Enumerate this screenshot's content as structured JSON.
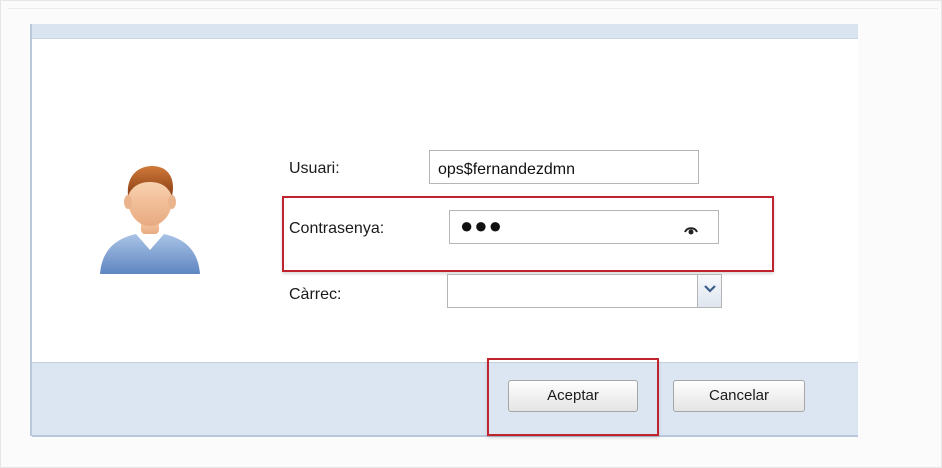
{
  "login": {
    "username_label": "Usuari:",
    "username_value": "ops$fernandezdmn",
    "password_label": "Contrasenya:",
    "password_mask": "●●●",
    "role_label": "Càrrec:",
    "role_value": ""
  },
  "buttons": {
    "accept": "Aceptar",
    "cancel": "Cancelar"
  },
  "icons": {
    "avatar": "user-avatar-icon",
    "show_password": "eye-icon",
    "dropdown": "chevron-down-icon"
  },
  "colors": {
    "highlight": "#c0232d",
    "footer": "#dce6f2",
    "header": "#dae4f0"
  }
}
